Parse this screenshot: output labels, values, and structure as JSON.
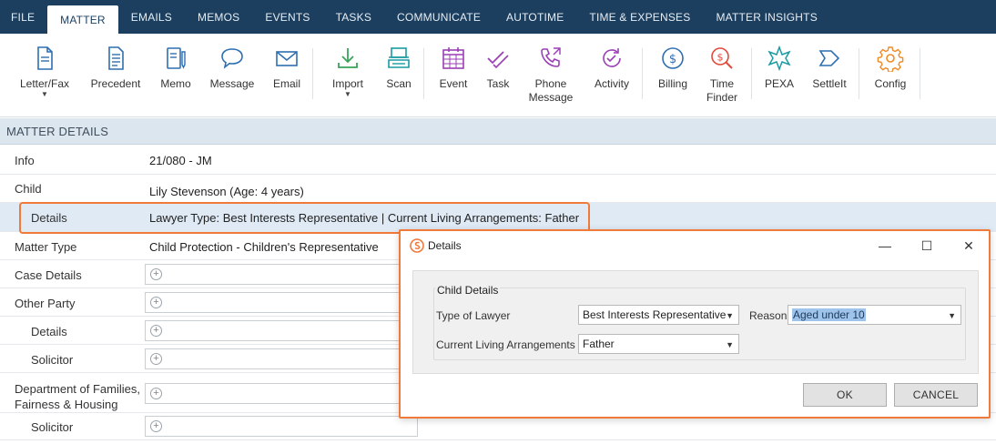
{
  "tabs": [
    "FILE",
    "MATTER",
    "EMAILS",
    "MEMOS",
    "EVENTS",
    "TASKS",
    "COMMUNICATE",
    "AUTOTIME",
    "TIME & EXPENSES",
    "MATTER INSIGHTS"
  ],
  "active_tab": "MATTER",
  "ribbon": {
    "letter_fax": "Letter/Fax",
    "precedent": "Precedent",
    "memo": "Memo",
    "message": "Message",
    "email": "Email",
    "import": "Import",
    "scan": "Scan",
    "event": "Event",
    "task": "Task",
    "phone_message_1": "Phone",
    "phone_message_2": "Message",
    "activity": "Activity",
    "billing": "Billing",
    "time_finder_1": "Time",
    "time_finder_2": "Finder",
    "pexa": "PEXA",
    "settleit": "SettleIt",
    "config": "Config"
  },
  "section_title": "MATTER DETAILS",
  "rows": {
    "info": {
      "label": "Info",
      "value": "21/080 - JM"
    },
    "child": {
      "label": "Child",
      "value": "Lily Stevenson (Age: 4 years)"
    },
    "details": {
      "label": "Details",
      "value": "Lawyer Type: Best Interests Representative | Current Living Arrangements: Father"
    },
    "matter_type": {
      "label": "Matter Type",
      "value": "Child Protection - Children's Representative"
    },
    "case_details": {
      "label": "Case Details"
    },
    "other_party": {
      "label": "Other Party"
    },
    "op_details": {
      "label": "Details"
    },
    "op_solicitor": {
      "label": "Solicitor"
    },
    "dept_1": {
      "label": "Department of Families,"
    },
    "dept_2": {
      "label": "Fairness & Housing"
    },
    "dept_solicitor": {
      "label": "Solicitor"
    }
  },
  "dialog": {
    "title": "Details",
    "group_title": "Child Details",
    "type_of_lawyer_label": "Type of Lawyer",
    "type_of_lawyer_value": "Best Interests Representative",
    "reason_label": "Reason",
    "reason_value": "Aged under 10",
    "living_label": "Current Living Arrangements",
    "living_value": "Father",
    "ok": "OK",
    "cancel": "CANCEL",
    "minimize_glyph": "—",
    "maximize_glyph": "☐",
    "close_glyph": "✕"
  },
  "colors": {
    "tabbar": "#1c3f5f",
    "accent_orange": "#f07a3a",
    "icon_blue": "#2f6fb0",
    "icon_teal": "#1a9aa0",
    "icon_green": "#3aa35a",
    "icon_purple": "#9b3fb5",
    "section_bg": "#dce6ef"
  }
}
